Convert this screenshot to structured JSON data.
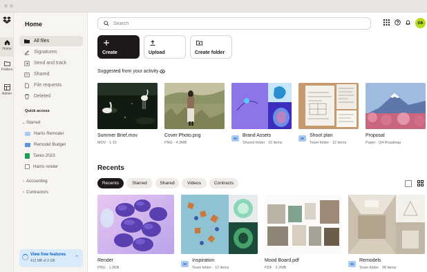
{
  "window": {
    "controls": [
      "close",
      "minimize",
      "zoom"
    ]
  },
  "rail": {
    "items": [
      {
        "label": "Home",
        "icon": "home-icon"
      },
      {
        "label": "Folders",
        "icon": "folder-icon"
      },
      {
        "label": "Admin",
        "icon": "admin-icon"
      }
    ]
  },
  "sidebar": {
    "title": "Home",
    "nav": [
      {
        "label": "All files",
        "icon": "files-icon"
      },
      {
        "label": "Signatures",
        "icon": "signature-icon"
      },
      {
        "label": "Send and track",
        "icon": "send-icon"
      },
      {
        "label": "Shared",
        "icon": "shared-icon"
      },
      {
        "label": "File requests",
        "icon": "file-request-icon"
      },
      {
        "label": "Deleted",
        "icon": "trash-icon"
      }
    ],
    "quick_access_label": "Quick access",
    "starred_label": "Starred",
    "starred_items": [
      {
        "label": "Harris Remodel",
        "icon": "folder-icon"
      },
      {
        "label": "Remodel Budget",
        "icon": "spreadsheet-icon"
      },
      {
        "label": "Taxes 2023",
        "icon": "sheet-icon"
      },
      {
        "label": "Harris render",
        "icon": "image-icon"
      }
    ],
    "groups": [
      "Accounting",
      "Contractors"
    ],
    "upgrade": {
      "title": "View free features",
      "subtitle": "412 MB of 2 GB"
    }
  },
  "header": {
    "search_placeholder": "Search",
    "avatar_initials": "DB"
  },
  "actions": [
    {
      "label": "Create",
      "icon": "plus-icon"
    },
    {
      "label": "Upload",
      "icon": "upload-icon"
    },
    {
      "label": "Create folder",
      "icon": "create-folder-icon"
    }
  ],
  "suggested": {
    "title": "Suggested from your activity",
    "items": [
      {
        "name": "Summer Brief.mov",
        "meta": "MOV · 1:10",
        "folder": false
      },
      {
        "name": "Cover Photo.png",
        "meta": "PNG · 4.3MB",
        "folder": false
      },
      {
        "name": "Brand Assets",
        "meta": "Shared folder · 15 items",
        "folder": true
      },
      {
        "name": "Shoot plan",
        "meta": "Team folder · 12 items",
        "folder": true
      },
      {
        "name": "Proposal",
        "meta": "Paper · Q4 Roadmap",
        "folder": false
      }
    ]
  },
  "recents": {
    "title": "Recents",
    "filters": [
      "Recents",
      "Starred",
      "Shared",
      "Videos",
      "Contracts"
    ],
    "active_filter": "Recents",
    "items": [
      {
        "name": "Render",
        "meta": "PNG · 1.2KB",
        "folder": false
      },
      {
        "name": "Inspiration",
        "meta": "Team folder · 12 items",
        "folder": true
      },
      {
        "name": "Mood Board.pdf",
        "meta": "PDF · 2.2MB",
        "folder": false
      },
      {
        "name": "Remodels",
        "meta": "Team folder · 38 items",
        "folder": true
      }
    ]
  },
  "colors": {
    "accent": "#1e1919",
    "brand_blue": "#0061fe",
    "avatar": "#b4dc19",
    "upgrade_bg": "#d9ebfb"
  }
}
